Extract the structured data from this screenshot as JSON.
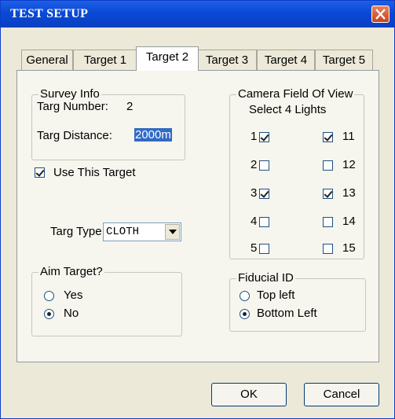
{
  "window": {
    "title": "TEST SETUP"
  },
  "tabs": [
    "General",
    "Target 1",
    "Target 2",
    "Target 3",
    "Target 4",
    "Target 5"
  ],
  "active_tab": "Target 2",
  "survey_info": {
    "title": "Survey Info",
    "targ_number_label": "Targ Number:",
    "targ_number_value": "2",
    "targ_distance_label": "Targ Distance:",
    "targ_distance_value": "2000m"
  },
  "use_this_target": {
    "label": "Use This Target",
    "checked": true
  },
  "targ_type": {
    "label": "Targ Type",
    "value": "CLOTH"
  },
  "camera_fov": {
    "title": "Camera Field Of View",
    "subtitle": "Select 4 Lights",
    "lights": [
      {
        "n": "1",
        "checked": true
      },
      {
        "n": "11",
        "checked": true
      },
      {
        "n": "2",
        "checked": false
      },
      {
        "n": "12",
        "checked": false
      },
      {
        "n": "3",
        "checked": true
      },
      {
        "n": "13",
        "checked": true
      },
      {
        "n": "4",
        "checked": false
      },
      {
        "n": "14",
        "checked": false
      },
      {
        "n": "5",
        "checked": false
      },
      {
        "n": "15",
        "checked": false
      }
    ]
  },
  "aim_target": {
    "title": "Aim Target?",
    "options": [
      "Yes",
      "No"
    ],
    "selected": "No"
  },
  "fiducial_id": {
    "title": "Fiducial ID",
    "options": [
      "Top left",
      "Bottom Left"
    ],
    "selected": "Bottom Left"
  },
  "buttons": {
    "ok": "OK",
    "cancel": "Cancel"
  }
}
